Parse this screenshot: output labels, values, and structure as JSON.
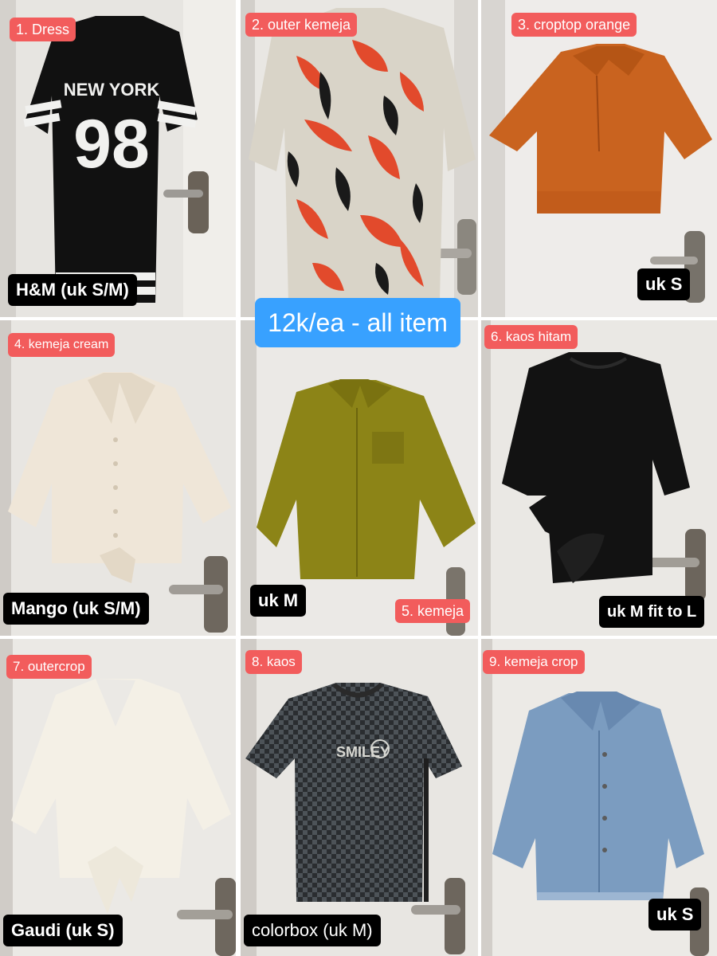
{
  "center_banner": "12k/ea - all item",
  "items": [
    {
      "title": "1. Dress",
      "size": "H&M (uk S/M)",
      "print_top": "NEW YORK",
      "print_num": "98"
    },
    {
      "title": "2. outer kemeja",
      "size": ""
    },
    {
      "title": "3. croptop orange",
      "size": "uk S"
    },
    {
      "title": "4. kemeja cream",
      "size": "Mango (uk S/M)"
    },
    {
      "title": "5. kemeja",
      "size": "uk M"
    },
    {
      "title": "6. kaos hitam",
      "size": "uk M fit to L"
    },
    {
      "title": "7. outercrop",
      "size": "Gaudi (uk S)"
    },
    {
      "title": "8. kaos",
      "size": "colorbox (uk M)",
      "print": "SMILEY"
    },
    {
      "title": "9. kemeja crop",
      "size": "uk S"
    }
  ],
  "colors": {
    "tag_bg": "#f25c5c",
    "size_bg": "#000000",
    "banner_bg": "#38a1ff"
  }
}
